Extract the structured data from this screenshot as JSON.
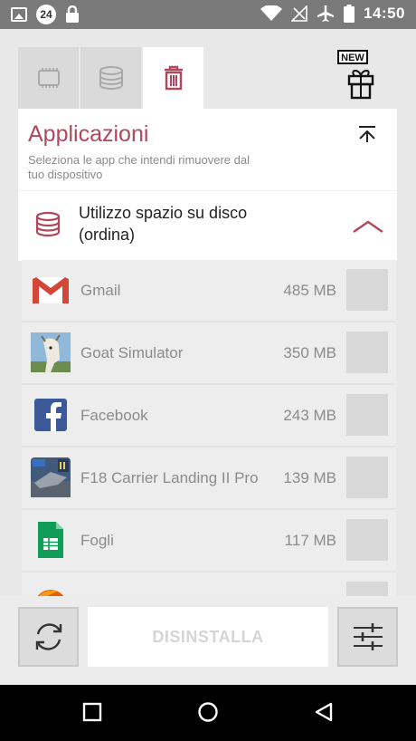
{
  "status_bar": {
    "notification_badge": "24",
    "time": "14:50"
  },
  "header": {
    "title": "Applicazioni",
    "subtitle": "Seleziona le app che intendi rimuovere dal tuo dispositivo"
  },
  "tabs": [
    {
      "icon": "chip-icon",
      "active": false
    },
    {
      "icon": "storage-stack-icon",
      "active": false
    },
    {
      "icon": "trash-icon",
      "active": true
    }
  ],
  "promo_badge": "NEW",
  "sort": {
    "label": "Utilizzo spazio su disco (ordina)"
  },
  "apps": [
    {
      "name": "Gmail",
      "size": "485 MB"
    },
    {
      "name": "Goat Simulator",
      "size": "350 MB"
    },
    {
      "name": "Facebook",
      "size": "243 MB"
    },
    {
      "name": "F18 Carrier Landing II Pro",
      "size": "139 MB"
    },
    {
      "name": "Fogli",
      "size": "117 MB"
    },
    {
      "name": "",
      "size": ""
    }
  ],
  "bottom_bar": {
    "uninstall_label": "DISINSTALLA"
  },
  "colors": {
    "accent": "#b0485d",
    "tab_inactive": "#dadada",
    "status_bar": "#7a7a7a"
  }
}
